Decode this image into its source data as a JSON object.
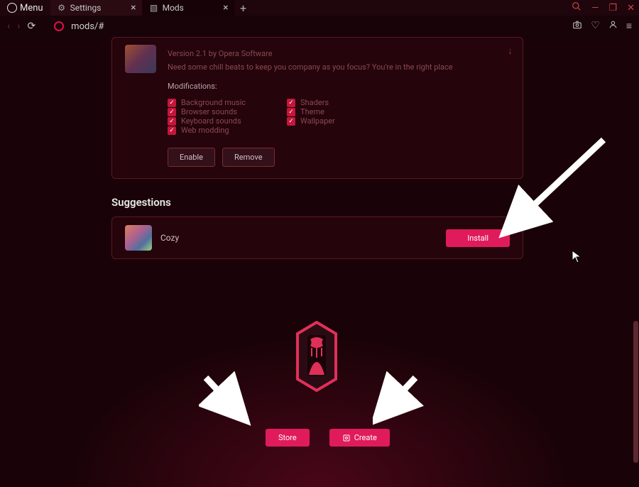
{
  "titlebar": {
    "menu_label": "Menu",
    "tabs": [
      {
        "label": "Settings",
        "icon": "gear-icon"
      },
      {
        "label": "Mods",
        "icon": "mods-icon"
      }
    ]
  },
  "urlbar": {
    "url": "mods/#"
  },
  "mod_card": {
    "version": "Version 2.1 by Opera Software",
    "description": "Need some chill beats to keep you company as you focus? You're in the right place",
    "modifications_label": "Modifications:",
    "checks_left": [
      "Background music",
      "Browser sounds",
      "Keyboard sounds",
      "Web modding"
    ],
    "checks_right": [
      "Shaders",
      "Theme",
      "Wallpaper"
    ],
    "enable_label": "Enable",
    "remove_label": "Remove"
  },
  "suggestions": {
    "title": "Suggestions",
    "item_name": "Cozy",
    "install_label": "Install"
  },
  "footer": {
    "store_label": "Store",
    "create_label": "Create"
  }
}
